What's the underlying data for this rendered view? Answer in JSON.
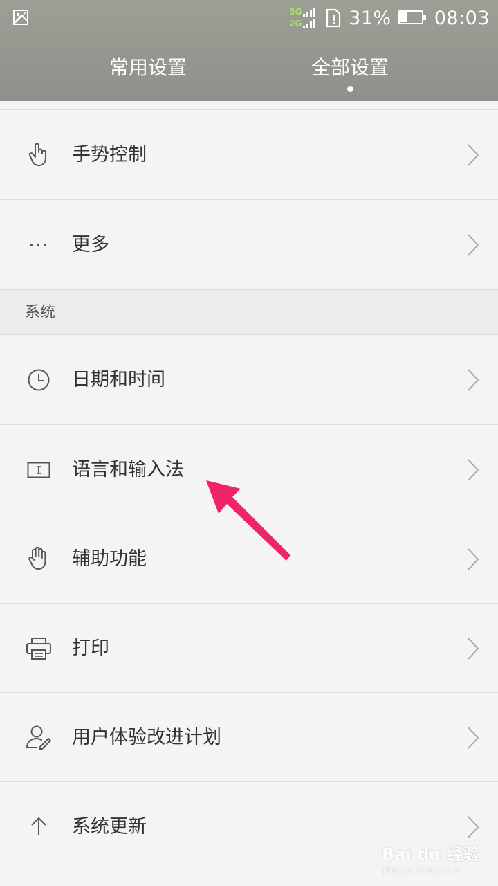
{
  "status_bar": {
    "network_top": "3G",
    "network_bottom": "2G",
    "battery_percent": "31%",
    "battery_level": 0.31,
    "time": "08:03",
    "icons": [
      "picture-notification-icon",
      "signal-icon",
      "sim-alert-icon",
      "battery-icon"
    ]
  },
  "tabs": [
    {
      "label": "常用设置",
      "active": false
    },
    {
      "label": "全部设置",
      "active": true
    }
  ],
  "items_top": [
    {
      "label": "手势控制",
      "icon": "gesture-hand-icon"
    },
    {
      "label": "更多",
      "icon": "more-dots-icon"
    }
  ],
  "section": {
    "title": "系统"
  },
  "items_system": [
    {
      "label": "日期和时间",
      "icon": "clock-icon"
    },
    {
      "label": "语言和输入法",
      "icon": "keyboard-input-icon"
    },
    {
      "label": "辅助功能",
      "icon": "accessibility-hand-icon"
    },
    {
      "label": "打印",
      "icon": "printer-icon"
    },
    {
      "label": "用户体验改进计划",
      "icon": "user-feedback-icon"
    },
    {
      "label": "系统更新",
      "icon": "arrow-up-icon"
    }
  ],
  "annotation": {
    "color": "#f0246a",
    "points_to": "语言和输入法"
  },
  "watermark": {
    "main": "Bai du 经验",
    "sub": "jingyan.baidu.com"
  },
  "colors": {
    "header": "#969990",
    "background": "#f4f4f4",
    "divider": "#dcdcdc",
    "text": "#333333",
    "network_tag": "#a6e65a"
  }
}
